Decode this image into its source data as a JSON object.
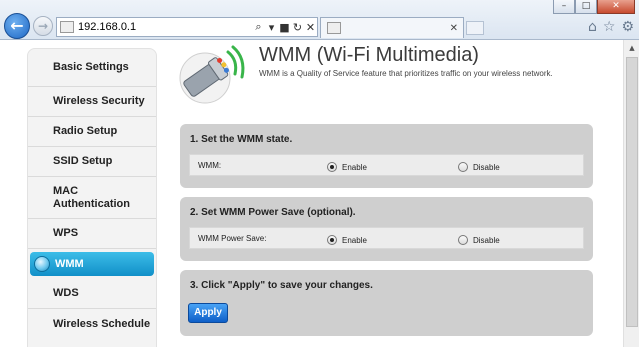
{
  "browser": {
    "address_url": "192.168.0.1",
    "tab_title": "",
    "window_buttons": {
      "minimize": "–",
      "maximize": "□",
      "close": "✕"
    },
    "icons": [
      "back-arrow-icon",
      "forward-arrow-icon",
      "search-icon",
      "lock-icon",
      "refresh-icon",
      "close-icon",
      "home-icon",
      "star-icon",
      "gear-icon"
    ]
  },
  "sidebar": {
    "items": [
      {
        "label": "Basic Settings"
      },
      {
        "label": "Wireless Security"
      },
      {
        "label": "Radio Setup"
      },
      {
        "label": "SSID Setup"
      },
      {
        "label": "MAC Authentication"
      },
      {
        "label": "WPS"
      },
      {
        "label": "WMM",
        "active": true
      },
      {
        "label": "WDS"
      },
      {
        "label": "Wireless Schedule"
      }
    ]
  },
  "header": {
    "title": "WMM (Wi-Fi Multimedia)",
    "subtitle": "WMM is a Quality of Service feature that prioritizes traffic on your wireless network."
  },
  "sections": {
    "wmm_state": {
      "heading": "1. Set the WMM state.",
      "field_label": "WMM:",
      "enable_label": "Enable",
      "disable_label": "Disable",
      "selected": "Enable"
    },
    "power_save": {
      "heading": "2. Set WMM Power Save (optional).",
      "field_label": "WMM Power Save:",
      "enable_label": "Enable",
      "disable_label": "Disable",
      "selected": "Enable"
    },
    "apply": {
      "heading": "3. Click \"Apply\" to save your changes.",
      "button_label": "Apply"
    }
  },
  "colors": {
    "accent_blue": "#118fc8",
    "apply_blue": "#0e5fc8",
    "panel_gray": "#cfcfcf",
    "signal_green": "#39b54a"
  }
}
